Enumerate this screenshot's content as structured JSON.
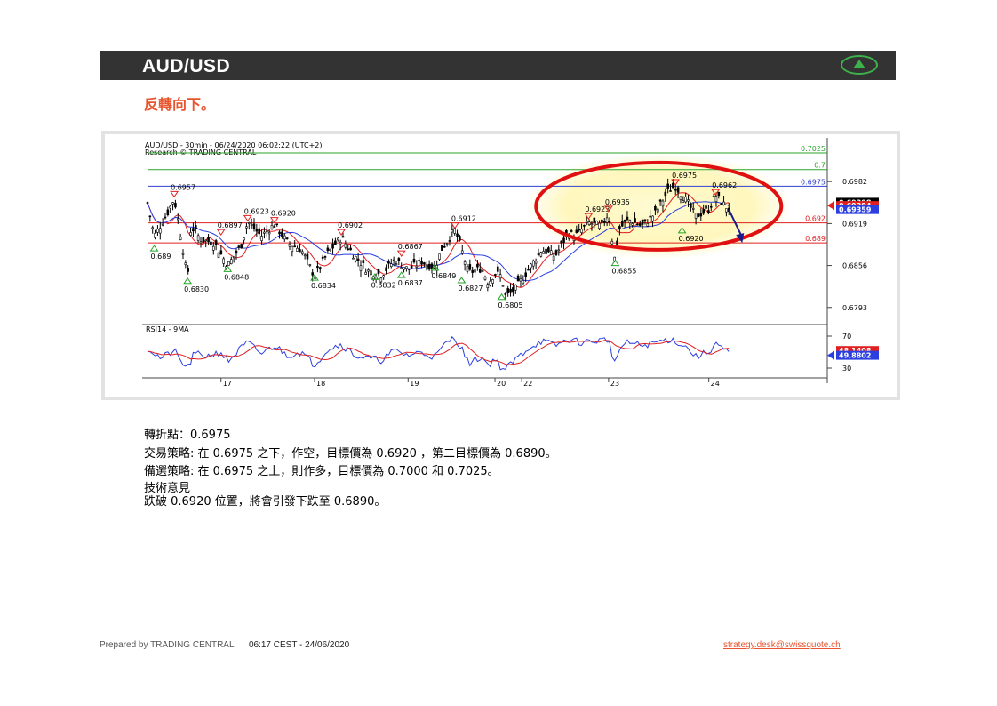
{
  "header": {
    "title": "AUD/USD",
    "up_icon": "up-triangle-icon",
    "accent": "#3db24a"
  },
  "subtitle": "反轉向下。",
  "chart_data": {
    "type": "candlestick",
    "title": "AUD/USD - 30min - 06/24/2020 06:02:22 (UTC+2)",
    "subtitle": "Research © TRADING CENTRAL",
    "ylim": [
      0.677,
      0.7045
    ],
    "y_ticks": [
      "0.6982",
      "0.6919",
      "0.6856",
      "0.6793"
    ],
    "x_ticks": [
      "17",
      "18",
      "19",
      "20",
      "22",
      "23",
      "24"
    ],
    "price_tags": [
      {
        "label": "0.69398",
        "value": 0.6951,
        "color": "#000000"
      },
      {
        "label": "0.69384",
        "value": 0.6946,
        "color": "#e02020"
      },
      {
        "label": "0.69359",
        "value": 0.694,
        "color": "#2b3fe0"
      }
    ],
    "levels": [
      {
        "label": "0.7025",
        "value": 0.7025,
        "color": "#2aa52a"
      },
      {
        "label": "0.7",
        "value": 0.7,
        "color": "#2aa52a"
      },
      {
        "label": "0.6975",
        "value": 0.6975,
        "color": "#3040d0"
      },
      {
        "label": "0.692",
        "value": 0.692,
        "color": "#e02020"
      },
      {
        "label": "0.689",
        "value": 0.689,
        "color": "#e02020"
      }
    ],
    "annotations": [
      {
        "label": "0.6957",
        "x": 0.04,
        "value": 0.6967,
        "kind": "high"
      },
      {
        "label": "0.689",
        "x": 0.01,
        "value": 0.6886,
        "kind": "low"
      },
      {
        "label": "0.6830",
        "x": 0.06,
        "value": 0.6837,
        "kind": "low"
      },
      {
        "label": "0.6897",
        "x": 0.11,
        "value": 0.691,
        "kind": "high"
      },
      {
        "label": "0.6848",
        "x": 0.12,
        "value": 0.6855,
        "kind": "low"
      },
      {
        "label": "0.6923",
        "x": 0.15,
        "value": 0.6931,
        "kind": "high"
      },
      {
        "label": "0.6920",
        "x": 0.19,
        "value": 0.6928,
        "kind": "high"
      },
      {
        "label": "0.6834",
        "x": 0.25,
        "value": 0.6842,
        "kind": "low"
      },
      {
        "label": "0.6902",
        "x": 0.29,
        "value": 0.691,
        "kind": "high"
      },
      {
        "label": "0.6832",
        "x": 0.34,
        "value": 0.6843,
        "kind": "low"
      },
      {
        "label": "0.6867",
        "x": 0.38,
        "value": 0.6878,
        "kind": "high"
      },
      {
        "label": "0.6837",
        "x": 0.38,
        "value": 0.6846,
        "kind": "low"
      },
      {
        "label": "0.6849",
        "x": 0.43,
        "value": 0.6857,
        "kind": "low"
      },
      {
        "label": "0.6912",
        "x": 0.46,
        "value": 0.692,
        "kind": "high"
      },
      {
        "label": "0.6827",
        "x": 0.47,
        "value": 0.6838,
        "kind": "low"
      },
      {
        "label": "0.6805",
        "x": 0.53,
        "value": 0.6813,
        "kind": "low"
      },
      {
        "label": "0.6923",
        "x": 0.66,
        "value": 0.6934,
        "kind": "high"
      },
      {
        "label": "0.6935",
        "x": 0.69,
        "value": 0.6945,
        "kind": "high"
      },
      {
        "label": "0.6855",
        "x": 0.7,
        "value": 0.6864,
        "kind": "low"
      },
      {
        "label": "0.6975",
        "x": 0.79,
        "value": 0.6985,
        "kind": "high"
      },
      {
        "label": "0.6962",
        "x": 0.85,
        "value": 0.697,
        "kind": "high"
      },
      {
        "label": "0.6920",
        "x": 0.8,
        "value": 0.6913,
        "kind": "low"
      }
    ],
    "price_path": [
      [
        0.0,
        0.695
      ],
      [
        0.01,
        0.69
      ],
      [
        0.03,
        0.6935
      ],
      [
        0.04,
        0.6957
      ],
      [
        0.05,
        0.69
      ],
      [
        0.06,
        0.6835
      ],
      [
        0.065,
        0.6915
      ],
      [
        0.08,
        0.6895
      ],
      [
        0.1,
        0.689
      ],
      [
        0.12,
        0.6856
      ],
      [
        0.14,
        0.6885
      ],
      [
        0.15,
        0.6922
      ],
      [
        0.17,
        0.69
      ],
      [
        0.19,
        0.6918
      ],
      [
        0.21,
        0.689
      ],
      [
        0.23,
        0.688
      ],
      [
        0.25,
        0.684
      ],
      [
        0.27,
        0.6875
      ],
      [
        0.29,
        0.6898
      ],
      [
        0.31,
        0.687
      ],
      [
        0.33,
        0.6848
      ],
      [
        0.35,
        0.6842
      ],
      [
        0.37,
        0.6865
      ],
      [
        0.39,
        0.685
      ],
      [
        0.41,
        0.6862
      ],
      [
        0.43,
        0.6852
      ],
      [
        0.44,
        0.688
      ],
      [
        0.46,
        0.691
      ],
      [
        0.47,
        0.688
      ],
      [
        0.48,
        0.6845
      ],
      [
        0.5,
        0.6852
      ],
      [
        0.51,
        0.683
      ],
      [
        0.52,
        0.6845
      ],
      [
        0.53,
        0.684
      ],
      [
        0.535,
        0.681
      ],
      [
        0.55,
        0.682
      ],
      [
        0.57,
        0.685
      ],
      [
        0.59,
        0.688
      ],
      [
        0.61,
        0.687
      ],
      [
        0.63,
        0.6905
      ],
      [
        0.64,
        0.69
      ],
      [
        0.66,
        0.692
      ],
      [
        0.68,
        0.6915
      ],
      [
        0.69,
        0.6935
      ],
      [
        0.7,
        0.686
      ],
      [
        0.705,
        0.691
      ],
      [
        0.72,
        0.6925
      ],
      [
        0.74,
        0.6915
      ],
      [
        0.76,
        0.6935
      ],
      [
        0.78,
        0.697
      ],
      [
        0.79,
        0.6975
      ],
      [
        0.81,
        0.6948
      ],
      [
        0.82,
        0.693
      ],
      [
        0.84,
        0.694
      ],
      [
        0.85,
        0.6962
      ],
      [
        0.86,
        0.695
      ],
      [
        0.87,
        0.694
      ]
    ],
    "forecast": [
      [
        0.87,
        0.694
      ],
      [
        0.89,
        0.689
      ]
    ],
    "rsi": {
      "label": "RSI14 - 9MA",
      "ylim": [
        20,
        80
      ],
      "ticks": [
        "70",
        "30"
      ],
      "tags": [
        {
          "label": "48.1408",
          "value": 52,
          "color": "#e02020"
        },
        {
          "label": "49.8802",
          "value": 46,
          "color": "#2b3fe0"
        }
      ],
      "path": [
        [
          0.0,
          55
        ],
        [
          0.02,
          42
        ],
        [
          0.04,
          52
        ],
        [
          0.05,
          38
        ],
        [
          0.06,
          30
        ],
        [
          0.07,
          48
        ],
        [
          0.09,
          45
        ],
        [
          0.11,
          50
        ],
        [
          0.12,
          38
        ],
        [
          0.14,
          55
        ],
        [
          0.15,
          62
        ],
        [
          0.17,
          48
        ],
        [
          0.19,
          58
        ],
        [
          0.21,
          46
        ],
        [
          0.23,
          50
        ],
        [
          0.25,
          34
        ],
        [
          0.27,
          54
        ],
        [
          0.29,
          60
        ],
        [
          0.31,
          46
        ],
        [
          0.33,
          42
        ],
        [
          0.35,
          40
        ],
        [
          0.37,
          52
        ],
        [
          0.39,
          46
        ],
        [
          0.41,
          50
        ],
        [
          0.43,
          44
        ],
        [
          0.45,
          64
        ],
        [
          0.46,
          68
        ],
        [
          0.47,
          55
        ],
        [
          0.48,
          36
        ],
        [
          0.5,
          44
        ],
        [
          0.51,
          34
        ],
        [
          0.52,
          42
        ],
        [
          0.53,
          30
        ],
        [
          0.535,
          28
        ],
        [
          0.55,
          40
        ],
        [
          0.57,
          55
        ],
        [
          0.59,
          64
        ],
        [
          0.61,
          58
        ],
        [
          0.63,
          66
        ],
        [
          0.65,
          62
        ],
        [
          0.67,
          64
        ],
        [
          0.69,
          66
        ],
        [
          0.7,
          32
        ],
        [
          0.705,
          54
        ],
        [
          0.72,
          62
        ],
        [
          0.74,
          58
        ],
        [
          0.76,
          62
        ],
        [
          0.78,
          66
        ],
        [
          0.79,
          64
        ],
        [
          0.81,
          54
        ],
        [
          0.82,
          44
        ],
        [
          0.84,
          50
        ],
        [
          0.85,
          62
        ],
        [
          0.86,
          54
        ],
        [
          0.87,
          48
        ]
      ]
    }
  },
  "analysis": {
    "pivot": "轉折點：0.6975",
    "strategy": "交易策略: 在 0.6975 之下，作空，目標價為  0.6920 ，第二目標價為  0.6890。",
    "alternative": "備選策略: 在 0.6975 之上，則作多，目標價為   0.7000 和 0.7025。",
    "comment_title": "技術意見",
    "comment": "跌破 0.6920 位置，將會引發下跌至  0.6890。"
  },
  "footer": {
    "prepared": "Prepared by TRADING CENTRAL",
    "timestamp": "06:17 CEST - 24/06/2020",
    "email": "strategy.desk@swissquote.ch"
  }
}
